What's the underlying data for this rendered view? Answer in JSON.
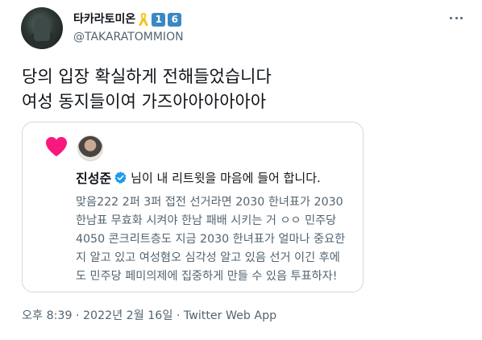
{
  "author": {
    "display_name": "타카라토미온",
    "badge_1": "1",
    "badge_2": "6",
    "handle": "@TAKARATOMMION"
  },
  "tweet": {
    "lines": [
      "당의 입장 확실하게 전해들었습니다",
      "여성 동지들이여 가즈아아아아아아"
    ]
  },
  "quoted_card": {
    "name": "진성준",
    "action_text": "님이 내 리트윗을 마음에 들어 합니다.",
    "body_lines": [
      "맞음222 2퍼 3퍼 접전 선거라면 2030 한녀표가 2030",
      "한남표 무효화 시켜야 한남 패배 시키는 거 ㅇㅇ 민주당",
      "4050 콘크리트층도 지금 2030 한녀표가 얼마나 중요한",
      "지 알고 있고 여성혐오 심각성 알고 있음 선거 이긴 후에",
      "도 민주당 페미의제에 집중하게 만들 수 있음 투표하자!"
    ],
    "heart_color": "#f91880",
    "verified_color": "#1d9bf0"
  },
  "meta": {
    "time": "오후 8:39",
    "separator": " · ",
    "date": "2022년 2월 16일",
    "source": "Twitter Web App"
  },
  "icons": {
    "more": "more-dots-icon",
    "ribbon": "yellow-ribbon-icon",
    "heart": "heart-icon",
    "verified": "verified-badge-icon"
  }
}
